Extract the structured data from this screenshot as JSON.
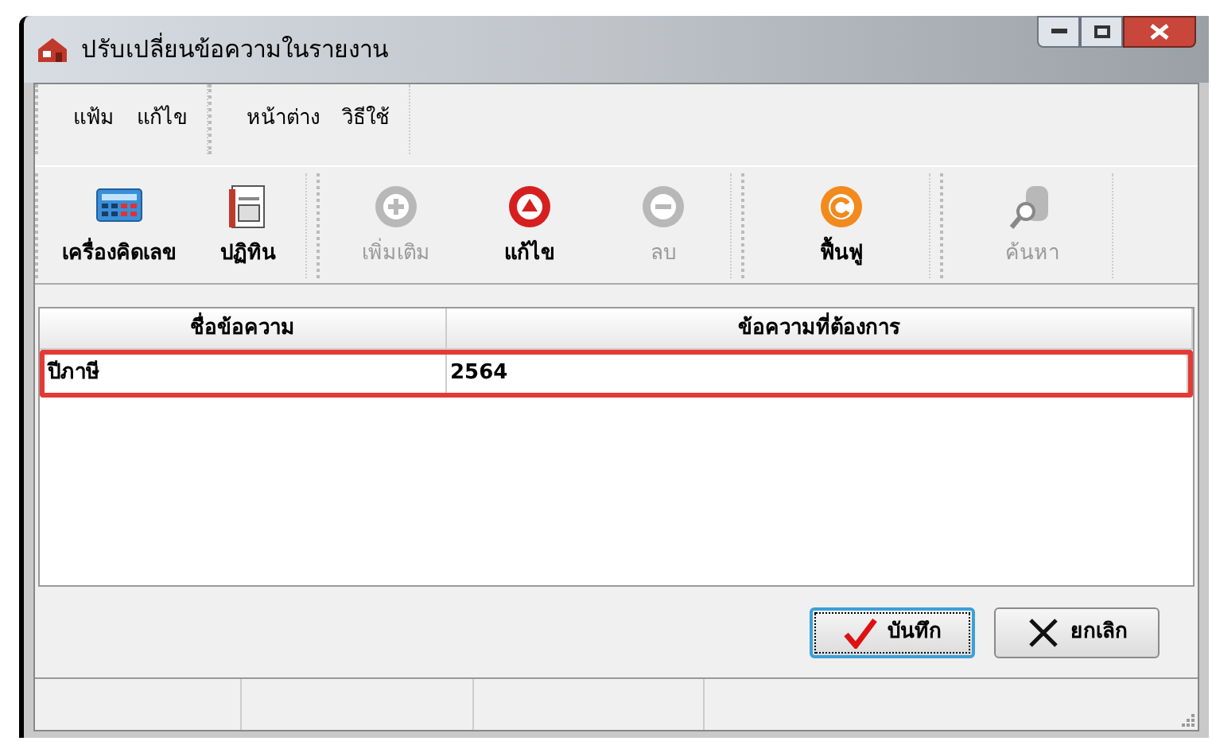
{
  "window": {
    "title": "ปรับเปลี่ยนข้อความในรายงาน"
  },
  "menu_groups": [
    {
      "items": [
        "แฟ้ม",
        "แก้ไข"
      ]
    },
    {
      "items": [
        "หน้าต่าง",
        "วิธีใช้"
      ]
    }
  ],
  "toolbar_groups": [
    {
      "items": [
        {
          "kind": "calculator",
          "label": "เครื่องคิดเลข",
          "disabled": false
        },
        {
          "kind": "calendar",
          "label": "ปฏิทิน",
          "disabled": false
        }
      ]
    },
    {
      "items": [
        {
          "kind": "add",
          "label": "เพิ่มเติม",
          "disabled": true
        },
        {
          "kind": "edit",
          "label": "แก้ไข",
          "disabled": false
        },
        {
          "kind": "delete",
          "label": "ลบ",
          "disabled": true
        }
      ]
    },
    {
      "items": [
        {
          "kind": "restore",
          "label": "ฟื้นฟู",
          "disabled": false
        }
      ]
    },
    {
      "items": [
        {
          "kind": "search",
          "label": "ค้นหา",
          "disabled": true
        }
      ]
    }
  ],
  "table": {
    "columns": [
      "ชื่อข้อความ",
      "ข้อความที่ต้องการ"
    ],
    "rows": [
      {
        "cells": [
          "ปีภาษี",
          "2564"
        ],
        "highlighted": true
      }
    ]
  },
  "buttons": [
    {
      "kind": "save",
      "label": "บันทึก",
      "focused": true
    },
    {
      "kind": "cancel",
      "label": "ยกเลิก",
      "focused": false
    }
  ]
}
